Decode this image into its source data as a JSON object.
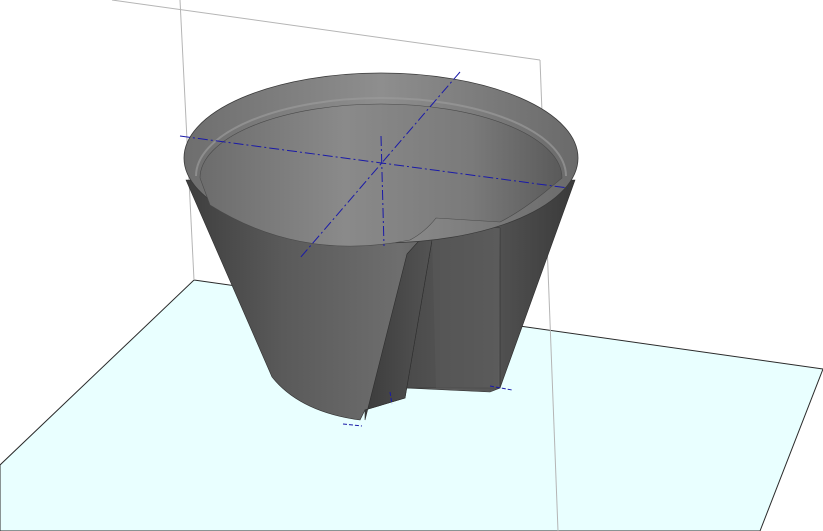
{
  "viewport": {
    "kind": "3d-model-view",
    "background_color": "#ffffff",
    "ground_plane_color": "#e9ffff",
    "reference_line_color": "#b0b0b0",
    "centerline_color": "#1a1aa8",
    "model_colors": {
      "outer_wall": "#5c5c5c",
      "rim": "#8a8a8a",
      "inner_wall": "#7a7a7a",
      "cut_face": "#6a6a6a"
    }
  }
}
